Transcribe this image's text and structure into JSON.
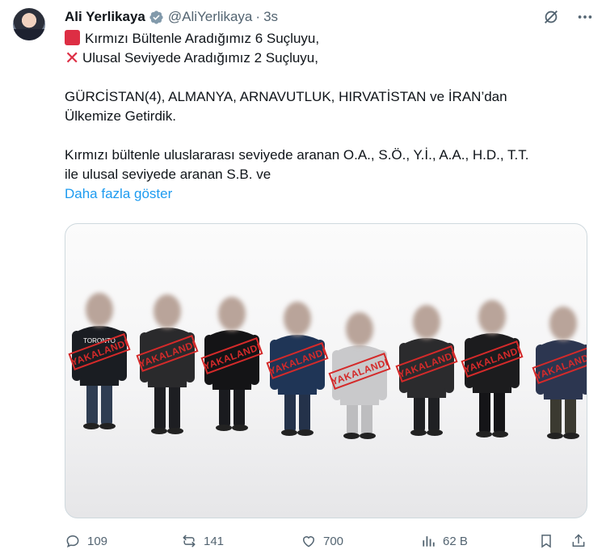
{
  "author": {
    "name": "Ali Yerlikaya",
    "handle": "@AliYerlikaya",
    "separator": "·",
    "time": "3s",
    "verified_icon": "verified-badge-icon"
  },
  "header_icons": [
    "grok-icon",
    "more-icon"
  ],
  "tweet": {
    "line1": "Kırmızı Bültenle Aradığımız 6 Suçluyu,",
    "line2": "Ulusal Seviyede Aradığımız 2 Suçluyu,",
    "line3": "GÜRCİSTAN(4), ALMANYA, ARNAVUTLUK, HIRVATİSTAN ve İRAN’dan",
    "line4": "Ülkemize Getirdik.",
    "line5": "Kırmızı bültenle uluslararası seviyede aranan O.A., S.Ö., Y.İ., A.A., H.D., T.T.",
    "line6": "ile ulusal seviyede aranan S.B. ve",
    "show_more": "Daha fazla göster"
  },
  "media": {
    "stamp_text": "YAKALANDI",
    "shirt_text": "TORONTO",
    "people": [
      {
        "shirt": "#1a1d22",
        "pants": "#2f3d52"
      },
      {
        "shirt": "#2a2a2c",
        "pants": "#1d1e22"
      },
      {
        "shirt": "#141416",
        "pants": "#1a1b1f"
      },
      {
        "shirt": "#1f3556",
        "pants": "#24324a"
      },
      {
        "shirt": "#c9c9cb",
        "pants": "#bdbdbf"
      },
      {
        "shirt": "#2b2b2d",
        "pants": "#1f2023"
      },
      {
        "shirt": "#1c1c1e",
        "pants": "#151518"
      },
      {
        "shirt": "#2c3650",
        "pants": "#3b3a31"
      }
    ]
  },
  "actions": {
    "replies": "109",
    "reposts": "141",
    "likes": "700",
    "views": "62 B"
  },
  "colors": {
    "accent": "#1d9bf0",
    "stamp": "#d42a2a",
    "muted": "#536471"
  }
}
